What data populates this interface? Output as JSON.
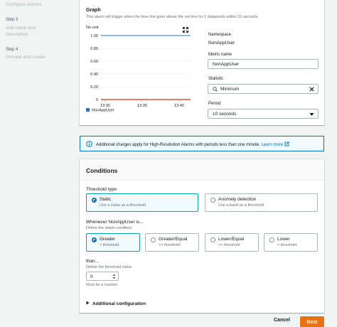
{
  "nav": {
    "configure_actions": "Configure actions",
    "step3_label": "Step 3",
    "step3_title": "Add name and description",
    "step4_label": "Step 4",
    "step4_title": "Preview and create"
  },
  "graph": {
    "title": "Graph",
    "description": "This alarm will trigger when the blue line goes above the red line for 1 datapoints within 10 seconds.",
    "unit_label": "No unit",
    "legend": "NonAppUser"
  },
  "chart_data": {
    "type": "line",
    "ylabel": "No unit",
    "ylim": [
      0,
      1.0
    ],
    "y_ticks": [
      "0",
      "0.20",
      "0.40",
      "0.60",
      "0.80",
      "1.00"
    ],
    "x_ticks": [
      "13:30",
      "13:35",
      "13:40"
    ],
    "series": [
      {
        "name": "NonAppUser",
        "color": "#2e73b8",
        "values": [
          1.0,
          1.0
        ]
      },
      {
        "color": "#d13212",
        "values": [
          0,
          0
        ]
      }
    ],
    "legend_position": "bottom-left",
    "grid": true
  },
  "details": {
    "namespace_label": "Namespace",
    "namespace_value": "NonAppUser",
    "metric_label": "Metric name",
    "metric_value": "NonAppUser",
    "statistic_label": "Statistic",
    "statistic_value": "Minimum",
    "period_label": "Period",
    "period_value": "10 seconds"
  },
  "alert": {
    "text": "Additional charges apply for High-Resolution Alarms with periods less than one minute.",
    "link": "Learn more"
  },
  "conditions": {
    "title": "Conditions",
    "threshold_type_label": "Threshold type",
    "threshold_types": [
      {
        "label": "Static",
        "desc": "Use a value as a threshold",
        "selected": true
      },
      {
        "label": "Anomaly detection",
        "desc": "Use a band as a threshold",
        "selected": false
      }
    ],
    "whenever_label": "Whenever NonAppUser is...",
    "whenever_desc": "Define the alarm condition.",
    "operators": [
      {
        "label": "Greater",
        "desc": "> threshold",
        "selected": true
      },
      {
        "label": "Greater/Equal",
        "desc": ">= threshold",
        "selected": false
      },
      {
        "label": "Lower/Equal",
        "desc": "<= threshold",
        "selected": false
      },
      {
        "label": "Lower",
        "desc": "< threshold",
        "selected": false
      }
    ],
    "than_label": "than...",
    "than_desc": "Define the threshold value.",
    "threshold_value": "0",
    "threshold_hint": "Must be a number",
    "additional_config": "Additional configuration"
  },
  "footer": {
    "cancel": "Cancel",
    "next": "Next"
  },
  "colors": {
    "accent": "#0073bb",
    "primary_button": "#ec7211",
    "selected_border": "#00a1c9"
  }
}
